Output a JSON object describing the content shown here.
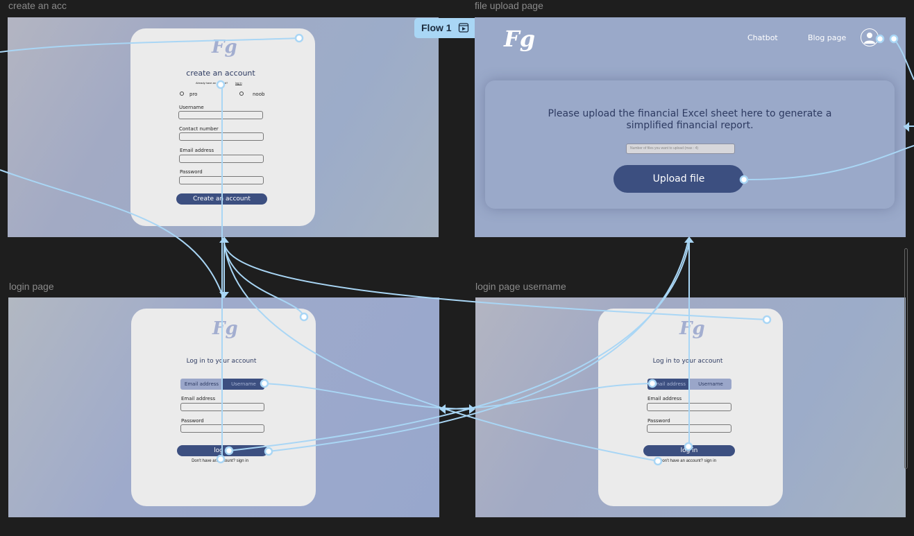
{
  "canvas": {
    "flow_label": "Flow 1",
    "frames": {
      "create_account": {
        "title": "create an acc"
      },
      "upload": {
        "title": "file upload page"
      },
      "login": {
        "title": "login page"
      },
      "login_username": {
        "title": "login page username"
      }
    }
  },
  "create_account": {
    "logo": "Fg",
    "heading": "create an account",
    "already_prefix": "Already have an account?",
    "already_link": "log in",
    "radio_options": [
      "pro",
      "noob"
    ],
    "fields": [
      "Username",
      "Contact number",
      "Email address",
      "Password"
    ],
    "submit": "Create an account"
  },
  "upload": {
    "logo": "Fg",
    "nav": {
      "chatbot": "Chatbot",
      "blog": "Blog page"
    },
    "message": "Please upload the financial Excel sheet here to generate a simplified financial report.",
    "count_placeholder": "Number of files you want to upload (max : 4)",
    "upload_button": "Upload file"
  },
  "login": {
    "logo": "Fg",
    "heading": "Log in to your account",
    "tabs": [
      "Email address",
      "Username"
    ],
    "fields": [
      "Email address",
      "Password"
    ],
    "submit": "log in",
    "signup_text": "Don't have an account? sign in"
  },
  "login_username": {
    "logo": "Fg",
    "heading": "Log in to your account",
    "tabs": [
      "Email address",
      "Username"
    ],
    "fields": [
      "Email address",
      "Password"
    ],
    "submit": "log in",
    "signup_text": "Don't have an account? sign in"
  },
  "colors": {
    "canvas_bg": "#1e1e1e",
    "card_bg": "#ebebeb",
    "primary": "#3c4f80",
    "wire": "#a9d6f5"
  }
}
